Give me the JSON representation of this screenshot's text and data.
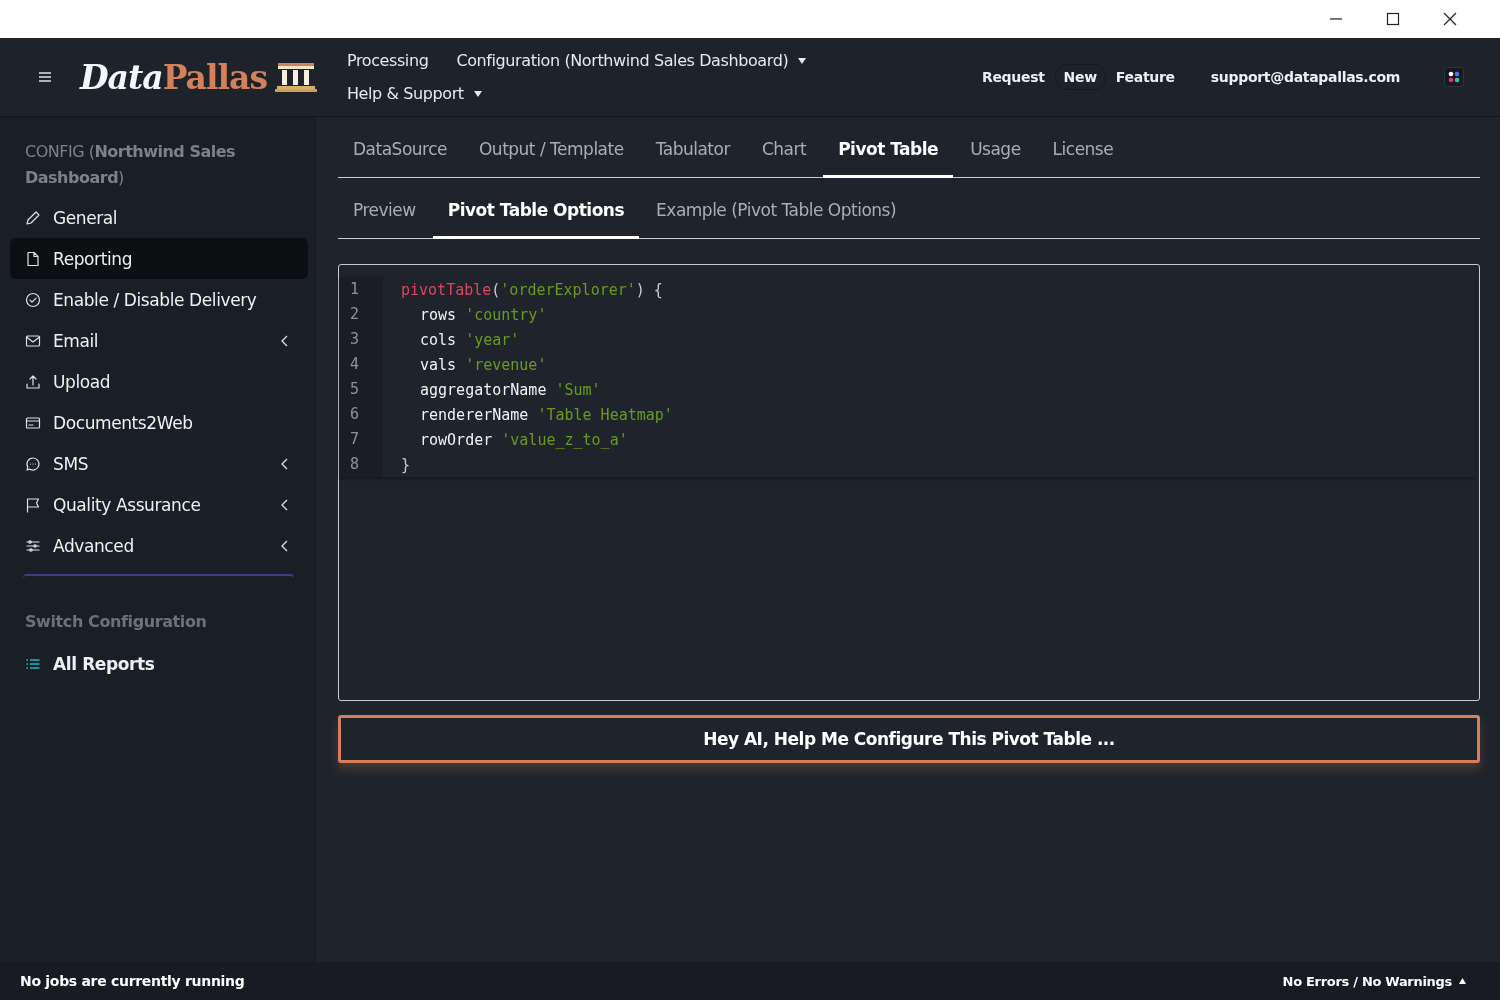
{
  "header": {
    "logo": {
      "part_1": "Data",
      "part_2": "Pallas"
    },
    "nav": [
      {
        "label": "Processing",
        "dropdown": false
      },
      {
        "label": "Configuration (Northwind Sales Dashboard)",
        "dropdown": true
      },
      {
        "label": "Help & Support",
        "dropdown": true
      }
    ],
    "feature_request": [
      "Request",
      "New",
      "Feature"
    ],
    "email": "support@datapallas.com"
  },
  "sidebar": {
    "title": "CONFIG (**Northwind Sales Dashboard**)",
    "items": [
      {
        "label": "General",
        "selected": false,
        "kind": "link"
      },
      {
        "label": "Reporting",
        "selected": true,
        "kind": "link"
      },
      {
        "label": "Enable / Disable Delivery",
        "selected": false,
        "kind": "link"
      },
      {
        "label": "Email",
        "selected": false,
        "kind": "group"
      },
      {
        "label": "Upload",
        "selected": false,
        "kind": "link"
      },
      {
        "label": "Documents2Web",
        "selected": false,
        "kind": "link"
      },
      {
        "label": "SMS",
        "selected": false,
        "kind": "group"
      },
      {
        "label": "Quality Assurance",
        "selected": false,
        "kind": "group"
      },
      {
        "label": "Advanced",
        "selected": false,
        "kind": "group"
      }
    ],
    "section_title": "Switch Configuration",
    "all_reports": "All Reports"
  },
  "tabs": [
    {
      "label": "DataSource",
      "selected": false
    },
    {
      "label": "Output / Template",
      "selected": false
    },
    {
      "label": "Tabulator",
      "selected": false
    },
    {
      "label": "Chart",
      "selected": false
    },
    {
      "label": "Pivot Table",
      "selected": true
    },
    {
      "label": "Usage",
      "selected": false
    },
    {
      "label": "License",
      "selected": false
    }
  ],
  "subtabs": [
    {
      "label": "Preview",
      "selected": false
    },
    {
      "label": "Pivot Table Options",
      "selected": true
    },
    {
      "label": "Example (Pivot Table Options)",
      "selected": false
    }
  ],
  "code": [
    {
      "number": "1",
      "indent": false,
      "tokens": [
        {
          "kind": "func",
          "text": "pivotTable"
        },
        {
          "kind": "punct",
          "text": "("
        },
        {
          "kind": "string",
          "text": "'orderExplorer'"
        },
        {
          "kind": "punct",
          "text": ") {"
        }
      ]
    },
    {
      "number": "2",
      "indent": true,
      "tokens": [
        {
          "kind": "key",
          "text": "rows"
        },
        {
          "kind": "string",
          "text": "'country'"
        }
      ]
    },
    {
      "number": "3",
      "indent": true,
      "tokens": [
        {
          "kind": "key",
          "text": "cols"
        },
        {
          "kind": "string",
          "text": "'year'"
        }
      ]
    },
    {
      "number": "4",
      "indent": true,
      "tokens": [
        {
          "kind": "key",
          "text": "vals"
        },
        {
          "kind": "string",
          "text": "'revenue'"
        }
      ]
    },
    {
      "number": "5",
      "indent": true,
      "tokens": [
        {
          "kind": "key",
          "text": "aggregatorName"
        },
        {
          "kind": "string",
          "text": "'Sum'"
        }
      ]
    },
    {
      "number": "6",
      "indent": true,
      "tokens": [
        {
          "kind": "key",
          "text": "rendererName"
        },
        {
          "kind": "string",
          "text": "'Table Heatmap'"
        }
      ]
    },
    {
      "number": "7",
      "indent": true,
      "tokens": [
        {
          "kind": "key",
          "text": "rowOrder"
        },
        {
          "kind": "string",
          "text": "'value_z_to_a'"
        }
      ]
    },
    {
      "number": "8",
      "indent": false,
      "tokens": [
        {
          "kind": "punct",
          "text": "}"
        }
      ]
    }
  ],
  "ai_button": "Hey AI, Help Me Configure This Pivot Table ...",
  "status_bar": {
    "left": "No jobs are currently running",
    "right": "No Errors / No Warnings"
  }
}
